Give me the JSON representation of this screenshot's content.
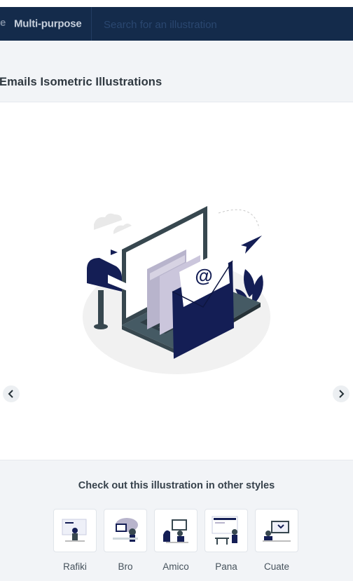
{
  "nav": {
    "cut_text": "e",
    "category": "Multi-purpose",
    "search_placeholder": "Search for an illustration"
  },
  "page": {
    "title": "Emails Isometric Illustrations"
  },
  "illustration": {
    "mail_symbol": "@"
  },
  "viewer": {
    "prev_icon": "chevron-left-icon",
    "next_icon": "chevron-right-icon"
  },
  "styles": {
    "heading": "Check out this illustration in other styles",
    "items": [
      {
        "label": "Rafiki"
      },
      {
        "label": "Bro"
      },
      {
        "label": "Amico"
      },
      {
        "label": "Pana"
      },
      {
        "label": "Cuate"
      }
    ]
  },
  "colors": {
    "navbar": "#142b4b",
    "navy": "#141e55",
    "dark_slate": "#37474f",
    "lavender": "#b8b4cc"
  }
}
